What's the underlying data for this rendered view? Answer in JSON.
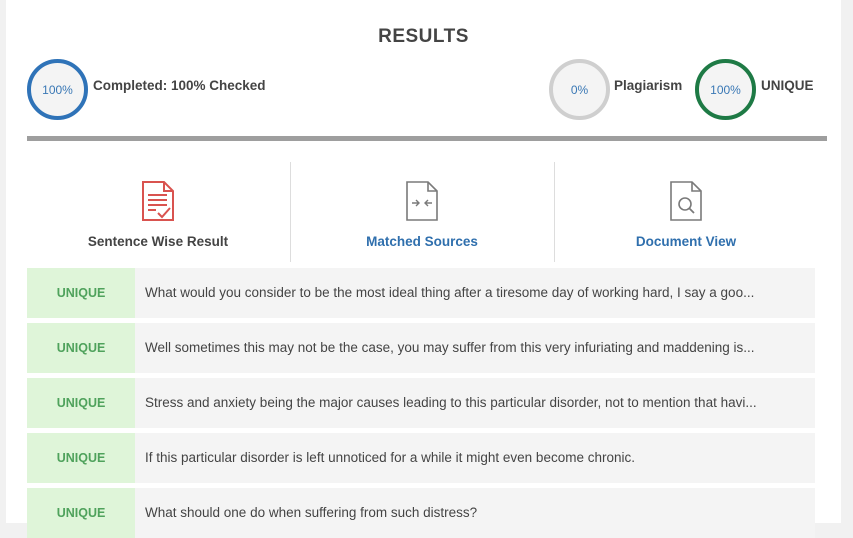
{
  "header": {
    "title": "RESULTS"
  },
  "stats": {
    "completed": {
      "percent": "100%",
      "label": "Completed: 100% Checked",
      "color": "#2f73b8"
    },
    "plagiarism": {
      "percent": "0%",
      "label": "Plagiarism",
      "color": "#cfcfcf"
    },
    "unique": {
      "percent": "100%",
      "label": "UNIQUE",
      "color": "#1e7a45"
    }
  },
  "tabs": [
    {
      "label": "Sentence Wise Result",
      "icon": "checked-document-icon",
      "color": "#444444"
    },
    {
      "label": "Matched Sources",
      "icon": "compare-document-icon",
      "color": "#2f6fad"
    },
    {
      "label": "Document View",
      "icon": "search-document-icon",
      "color": "#2f6fad"
    }
  ],
  "results": [
    {
      "status": "UNIQUE",
      "text": "What would you consider to be the most ideal thing after a tiresome day of working hard, I say a goo..."
    },
    {
      "status": "UNIQUE",
      "text": "Well sometimes this may not be the case, you may suffer from this very infuriating and maddening is..."
    },
    {
      "status": "UNIQUE",
      "text": "Stress and anxiety being the major causes leading to this particular disorder, not to mention that havi..."
    },
    {
      "status": "UNIQUE",
      "text": "If this particular disorder is left unnoticed for a while it might even become chronic."
    },
    {
      "status": "UNIQUE",
      "text": "What should one do when suffering from such distress?"
    }
  ]
}
